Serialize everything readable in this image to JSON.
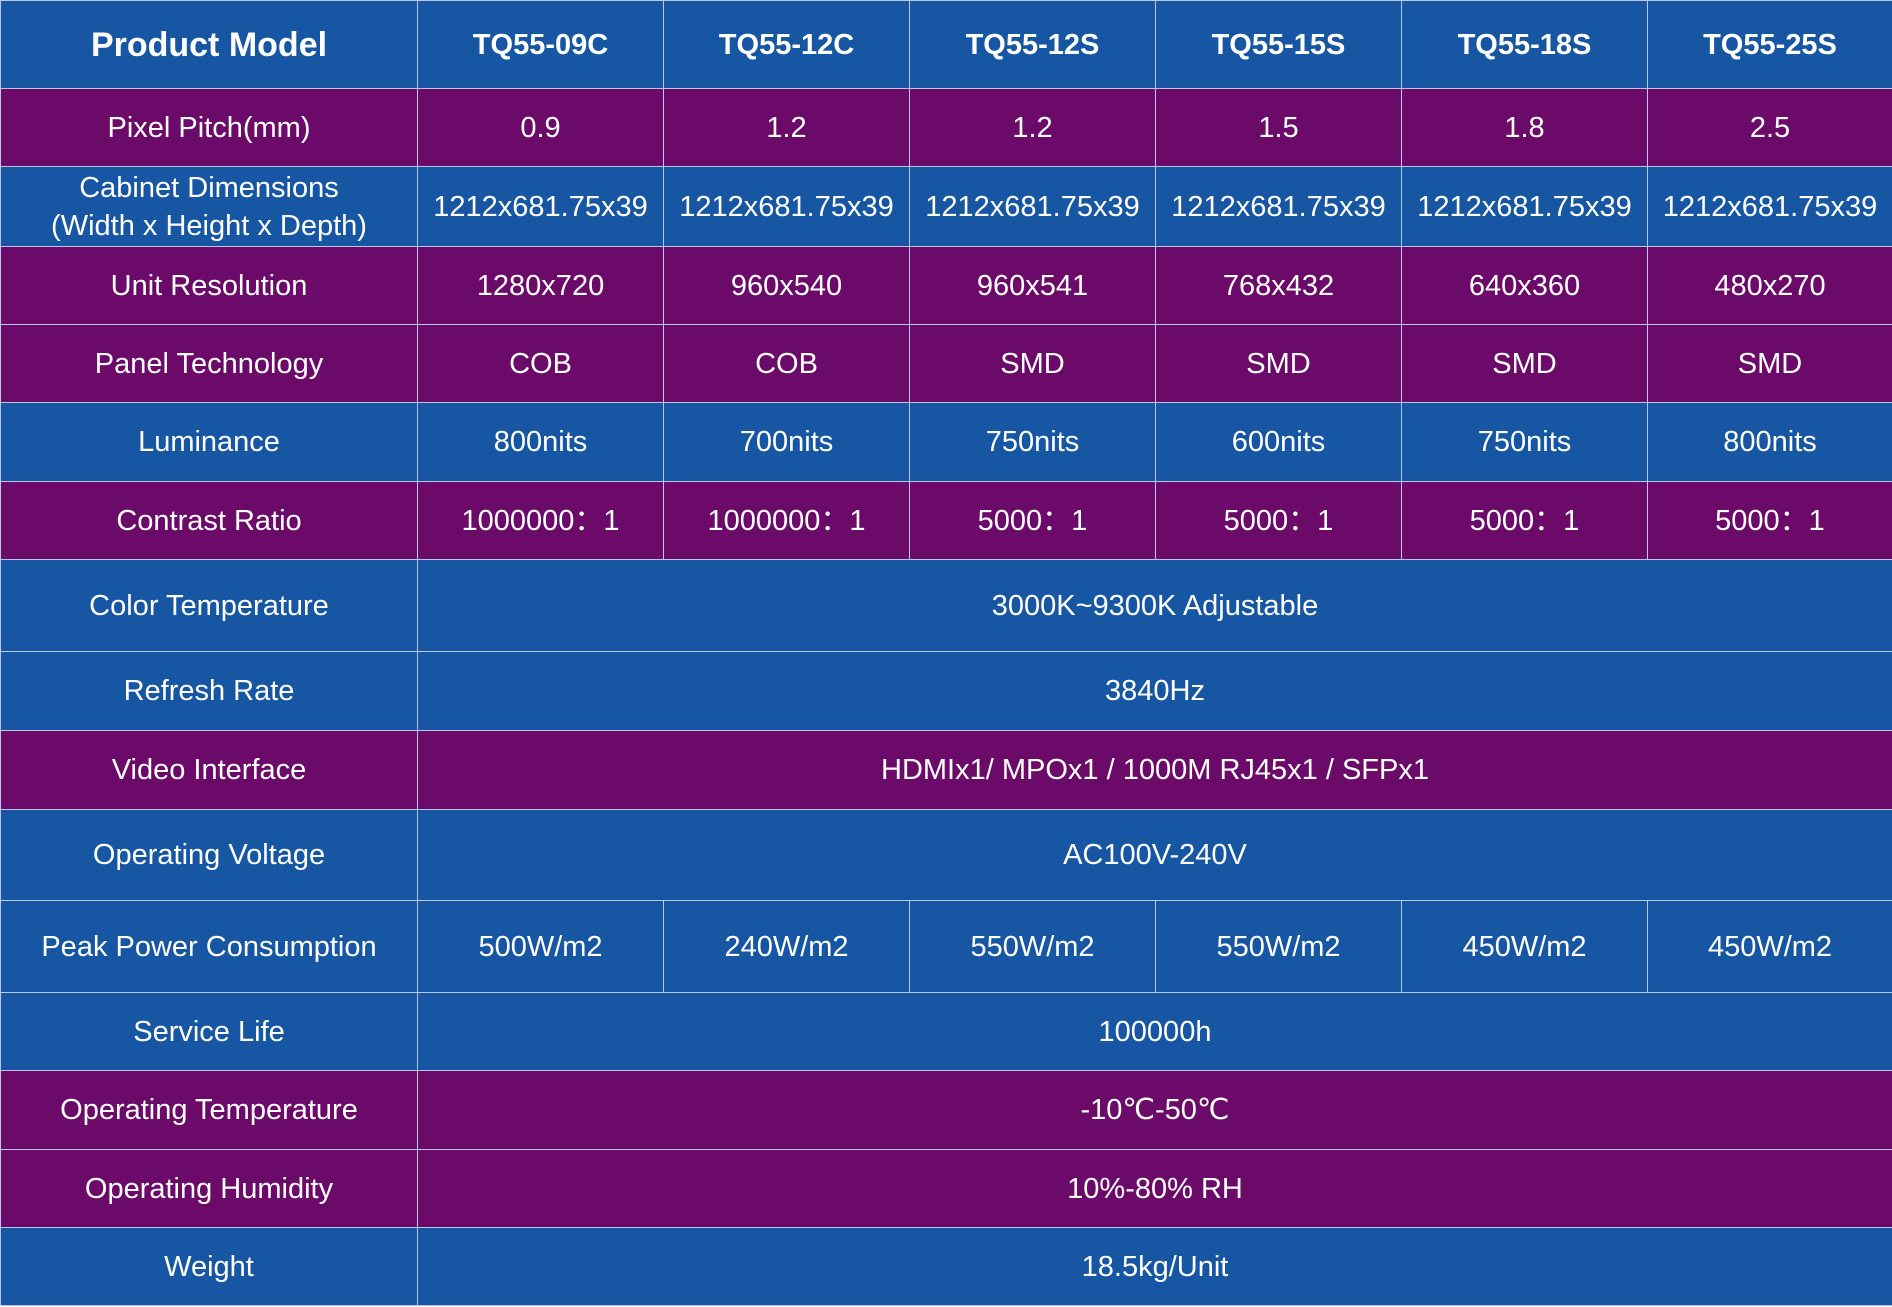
{
  "colors": {
    "blue": "#1656a3",
    "purple": "#6b0a68",
    "text": "#ffffff",
    "grid": "#b9c7e6"
  },
  "header": {
    "label": "Product Model",
    "models": [
      "TQ55-09C",
      "TQ55-12C",
      "TQ55-12S",
      "TQ55-15S",
      "TQ55-18S",
      "TQ55-25S"
    ]
  },
  "rows": [
    {
      "label": "Pixel Pitch(mm)",
      "color": "purple",
      "values": [
        "0.9",
        "1.2",
        "1.2",
        "1.5",
        "1.8",
        "2.5"
      ]
    },
    {
      "label": "Cabinet Dimensions",
      "label2": "(Width x Height x Depth)",
      "color": "blue",
      "values": [
        "1212x681.75x39",
        "1212x681.75x39",
        "1212x681.75x39",
        "1212x681.75x39",
        "1212x681.75x39",
        "1212x681.75x39"
      ]
    },
    {
      "label": "Unit Resolution",
      "color": "purple",
      "values": [
        "1280x720",
        "960x540",
        "960x541",
        "768x432",
        "640x360",
        "480x270"
      ]
    },
    {
      "label": "Panel Technology",
      "color": "purple",
      "values": [
        "COB",
        "COB",
        "SMD",
        "SMD",
        "SMD",
        "SMD"
      ]
    },
    {
      "label": "Luminance",
      "color": "blue",
      "values": [
        "800nits",
        "700nits",
        "750nits",
        "600nits",
        "750nits",
        "800nits"
      ]
    },
    {
      "label": "Contrast Ratio",
      "color": "purple",
      "values": [
        "1000000：1",
        "1000000：1",
        "5000：1",
        "5000：1",
        "5000：1",
        "5000：1"
      ]
    },
    {
      "label": "Color Temperature",
      "color": "blue",
      "span_value": "3000K~9300K Adjustable"
    },
    {
      "label": "Refresh Rate",
      "color": "blue",
      "span_value": "3840Hz"
    },
    {
      "label": "Video Interface",
      "color": "purple",
      "span_value": "HDMIx1/ MPOx1 / 1000M RJ45x1 / SFPx1"
    },
    {
      "label": "Operating Voltage",
      "color": "blue",
      "span_value": "AC100V-240V"
    },
    {
      "label": "Peak Power Consumption",
      "color": "blue",
      "values": [
        "500W/m2",
        "240W/m2",
        "550W/m2",
        "550W/m2",
        "450W/m2",
        "450W/m2"
      ]
    },
    {
      "label": "Service Life",
      "color": "blue",
      "span_value": "100000h"
    },
    {
      "label": "Operating Temperature",
      "color": "purple",
      "span_value": "-10℃-50℃"
    },
    {
      "label": "Operating Humidity",
      "color": "purple",
      "span_value": "10%-80% RH"
    },
    {
      "label": "Weight",
      "color": "blue",
      "span_value": "18.5kg/Unit"
    }
  ]
}
